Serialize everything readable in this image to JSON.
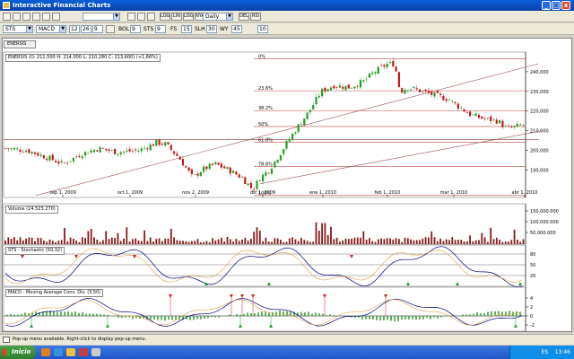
{
  "window": {
    "title": "Interactive Financial Charts",
    "controls": {
      "minimize": "_",
      "maximize": "□",
      "close": "x"
    }
  },
  "toolbar1": {
    "period_select": "Daily",
    "period_arrow": "▼",
    "buttons": [
      "LOG",
      "LIN",
      "LOG",
      "NYA",
      "DEL",
      "RSI"
    ],
    "blank_select": ""
  },
  "toolbar2": {
    "symbol": "STS",
    "indicator": "MACD",
    "params": [
      "12",
      "26",
      "9"
    ],
    "labels": [
      "BOL",
      "STS",
      "FS",
      "SLH",
      "WY"
    ],
    "label_values": [
      "9",
      "9",
      "15",
      "30",
      "45",
      "10"
    ]
  },
  "tab": {
    "label": "ENERSIS"
  },
  "price_pane": {
    "legend": "ENERSIS (O: 211,500  H: 214,000  L: 210,280  C: 213,600) (+1,66%)",
    "ylabels": [
      "240,000",
      "230,000",
      "220,000",
      "210,000",
      "200,000",
      "190,000"
    ],
    "yvalues": [
      240,
      230,
      220,
      210,
      200,
      190
    ],
    "xlabels": [
      "sep 1, 2009",
      "oct 1, 2009",
      "nov 2, 2009",
      "dic 1, 2009",
      "ene 1, 2010",
      "feb 1, 2010",
      "mar 1, 2010",
      "abr 1, 2010"
    ],
    "fib_labels": [
      "0%",
      "23.6%",
      "38.2%",
      "50%",
      "61.8%",
      "78.6%",
      "100%"
    ],
    "fib_values": [
      246.5,
      230.3,
      220.2,
      212.1,
      204.0,
      191.8,
      177.0
    ]
  },
  "volume_pane": {
    "legend": "Volume (24.523.270)",
    "ylabels": [
      "150.000.000",
      "100.000.000",
      "50.000.000"
    ]
  },
  "sts_pane": {
    "legend": "STS - Stochastic (50,32)",
    "ylabels": [
      "80",
      "50",
      "20"
    ]
  },
  "macd_pane": {
    "legend": "MACD - Moving Average Conv. Div. (3,50)",
    "ylabels": [
      "4",
      "2",
      "0",
      "-2"
    ]
  },
  "colors": {
    "up": "#22a022",
    "down": "#c81818",
    "volume": "#8b1a1a",
    "fib": "#b84848",
    "trend": "#a05050",
    "stoch_k": "#000080",
    "stoch_d": "#e0a040",
    "macd": "#000080",
    "signal": "#e0a040",
    "hist": "#3aa03a",
    "marker_up": "#20a020",
    "marker_down": "#d02020"
  },
  "status": {
    "text": "Pop-up menu available. Right-click to display pop-up menu."
  },
  "taskbar": {
    "start": "Inicio",
    "lang": "ES",
    "clock": "13:46"
  }
}
